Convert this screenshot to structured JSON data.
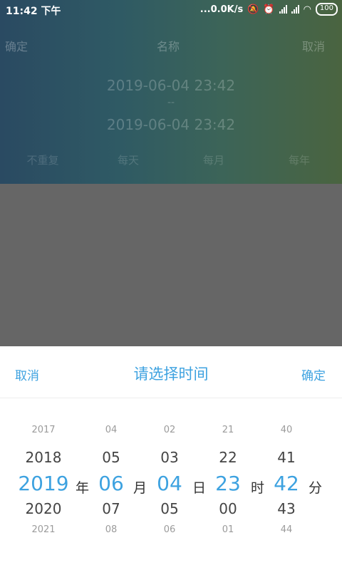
{
  "status_bar": {
    "time": "11:42 下午",
    "network_speed": "...0.0K/s",
    "battery": "100"
  },
  "header": {
    "confirm_label": "确定",
    "title": "名称",
    "cancel_label": "取消"
  },
  "time_range": {
    "start": "2019-06-04 23:42",
    "separator": "--",
    "end": "2019-06-04 23:42"
  },
  "repeat_options": [
    "不重复",
    "每天",
    "每月",
    "每年"
  ],
  "picker": {
    "cancel_label": "取消",
    "title": "请选择时间",
    "confirm_label": "确定",
    "columns": [
      {
        "unit": "年",
        "items": [
          "2017",
          "2018",
          "2019",
          "2020",
          "2021"
        ],
        "selected": "2019"
      },
      {
        "unit": "月",
        "items": [
          "04",
          "05",
          "06",
          "07",
          "08"
        ],
        "selected": "06"
      },
      {
        "unit": "日",
        "items": [
          "02",
          "03",
          "04",
          "05",
          "06"
        ],
        "selected": "04"
      },
      {
        "unit": "时",
        "items": [
          "21",
          "22",
          "23",
          "00",
          "01"
        ],
        "selected": "23"
      },
      {
        "unit": "分",
        "items": [
          "40",
          "41",
          "42",
          "43",
          "44"
        ],
        "selected": "42"
      }
    ]
  }
}
